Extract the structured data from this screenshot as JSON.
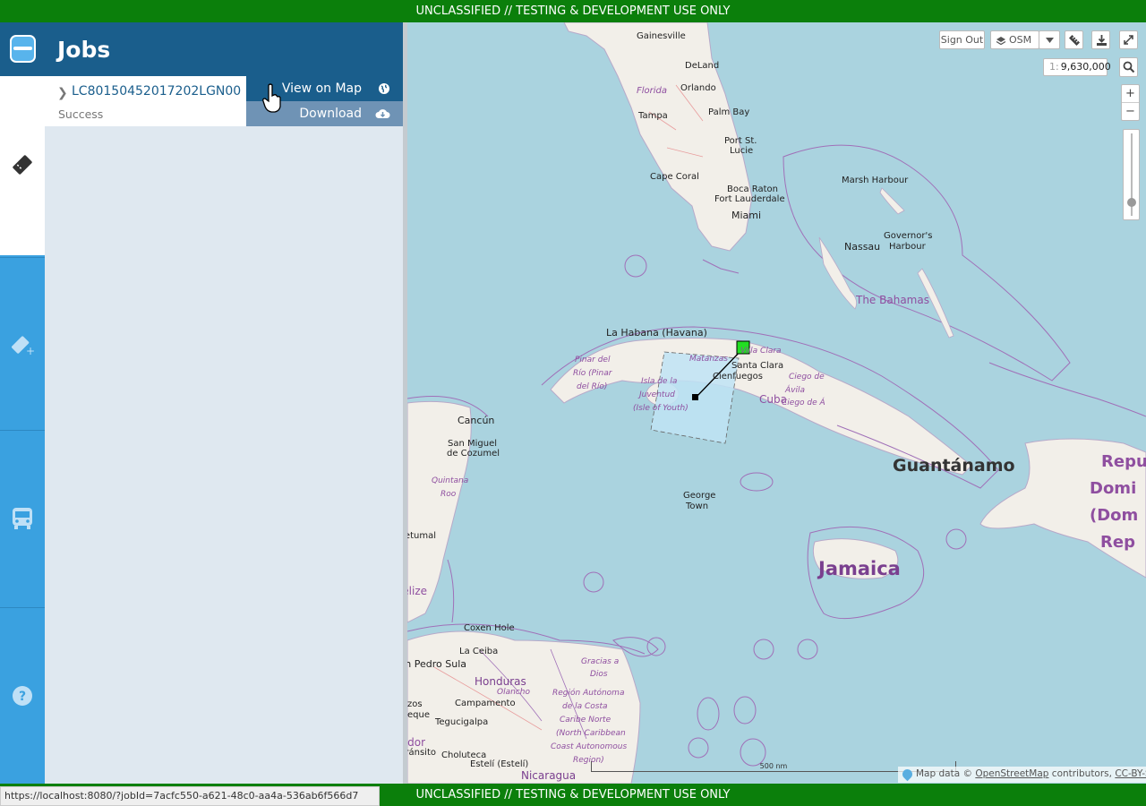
{
  "banner": {
    "top_text": "UNCLASSIFIED // TESTING & DEVELOPMENT USE ONLY",
    "bottom_text": "UNCLASSIFIED // TESTING & DEVELOPMENT USE ONLY"
  },
  "rail": {
    "items": [
      {
        "icon": "app-logo-icon"
      },
      {
        "icon": "jobs-ticket-icon",
        "active": true
      },
      {
        "icon": "create-job-icon"
      },
      {
        "icon": "bus-icon"
      },
      {
        "icon": "help-icon"
      }
    ],
    "accent_color": "#3aa1e0",
    "header_color": "#1a5e8c"
  },
  "panel": {
    "title": "Jobs",
    "jobs": [
      {
        "title": "LC80150452017202LGN00",
        "status": "Success"
      }
    ],
    "job_menu": {
      "view_on_map": "View on Map",
      "download": "Download"
    }
  },
  "map": {
    "controls": {
      "sign_out": "Sign Out",
      "basemap": "OSM",
      "scale_prefix": "1:",
      "scale_value": "9,630,000",
      "zoom_in": "+",
      "zoom_out": "−"
    },
    "labels": {
      "gainesville": "Gainesville",
      "deland": "DeLand",
      "orlando": "Orlando",
      "florida": "Florida",
      "tampa": "Tampa",
      "palm_bay": "Palm Bay",
      "port_st_lucie_1": "Port St.",
      "port_st_lucie_2": "Lucie",
      "cape_coral": "Cape Coral",
      "boca_raton": "Boca Raton",
      "fort_lauderdale": "Fort Lauderdale",
      "miami": "Miami",
      "marsh_harbour": "Marsh Harbour",
      "nassau": "Nassau",
      "governors_harbour_1": "Governor's",
      "governors_harbour_2": "Harbour",
      "the_bahamas": "The Bahamas",
      "la_habana": "La Habana (Havana)",
      "villa_clara": "Villa Clara",
      "pinar_1": "Pinar del",
      "pinar_2": "Río (Pinar",
      "pinar_3": "del Río)",
      "matanzas": "Matanzas",
      "santa_clara": "Santa Clara",
      "cienfuegos": "Cienfuegos",
      "ciego_1": "Ciego de",
      "ciego_2": "Ávila",
      "ciego_3": "Ciego de Á",
      "isla_1": "Isla de la",
      "isla_2": "Juventud",
      "isla_3": "(Isle of Youth)",
      "cuba": "Cuba",
      "cancun": "Cancún",
      "san_miguel_1": "San Miguel",
      "san_miguel_2": "de Cozumel",
      "quintana_1": "Quintana",
      "quintana_2": "Roo",
      "guantanamo": "Guantánamo",
      "george_town_1": "George",
      "george_town_2": "Town",
      "chetumal": "Chetumal",
      "belize": "Belize",
      "jamaica": "Jamaica",
      "repub_1": "Repu",
      "repub_2": "Domi",
      "repub_3": "(Dom",
      "repub_4": "Rep",
      "coxen_hole": "Coxen Hole",
      "la_ceiba": "La Ceiba",
      "san_pedro_sula": "San Pedro Sula",
      "gracias_1": "Gracias a",
      "gracias_2": "Dios",
      "honduras": "Honduras",
      "olancho": "Olancho",
      "region_1": "Región Autónoma",
      "region_2": "de la Costa",
      "region_3": "Caribe Norte",
      "region_4": "(North Caribbean",
      "region_5": "Coast Autonomous",
      "region_6": "Region)",
      "campamento": "Campamento",
      "tegucigalpa": "Tegucigalpa",
      "choluteca": "Choluteca",
      "esteli": "Estelí (Estelí)",
      "nicaragua": "Nicaragua",
      "salvador": "Salvador",
      "transito": "Tránsito",
      "izos": "zos",
      "eque": "eque"
    },
    "scalebar": "500 nm",
    "attribution": {
      "prefix": "Map data ©",
      "osm": "OpenStreetMap",
      "contributors": "contributors,",
      "license": "CC-BY-SA"
    },
    "feature_colors": {
      "footprint_fill": "#bfe3f5",
      "marker": "#22dd22",
      "border": "#a070b8"
    }
  },
  "status_bar": {
    "url": "https://localhost:8080/?jobId=7acfc550-a621-48c0-aa4a-536ab6f566d7"
  }
}
